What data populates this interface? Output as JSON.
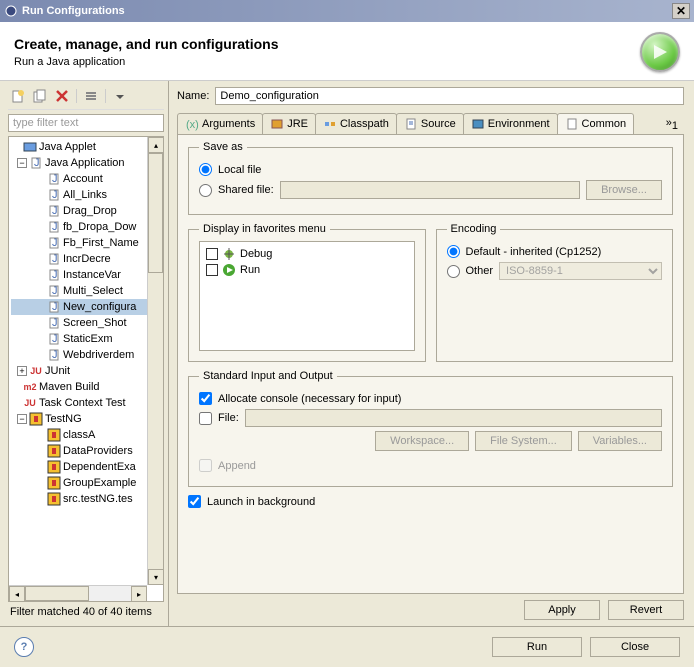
{
  "title": "Run Configurations",
  "header": {
    "title": "Create, manage, and run configurations",
    "subtitle": "Run a Java application"
  },
  "filter_placeholder": "type filter text",
  "filter_status": "Filter matched 40 of 40 items",
  "tree": {
    "java_applet": "Java Applet",
    "java_application": "Java Application",
    "items": [
      "Account",
      "All_Links",
      "Drag_Drop",
      "fb_Dropa_Dow",
      "Fb_First_Name",
      "IncrDecre",
      "InstanceVar",
      "Multi_Select",
      "New_configura",
      "Screen_Shot",
      "StaticExm",
      "Webdriverdem"
    ],
    "junit": "JUnit",
    "maven": "Maven Build",
    "task_context": "Task Context Test",
    "testng": "TestNG",
    "testng_items": [
      "classA",
      "DataProviders",
      "DependentExa",
      "GroupExample",
      "src.testNG.tes"
    ]
  },
  "name_label": "Name:",
  "name_value": "Demo_configuration",
  "tabs": {
    "arguments": "Arguments",
    "jre": "JRE",
    "classpath": "Classpath",
    "source": "Source",
    "environment": "Environment",
    "common": "Common",
    "overflow": "1"
  },
  "saveas": {
    "legend": "Save as",
    "local": "Local file",
    "shared": "Shared file:",
    "browse": "Browse..."
  },
  "fav": {
    "legend": "Display in favorites menu",
    "debug": "Debug",
    "run": "Run"
  },
  "enc": {
    "legend": "Encoding",
    "default": "Default - inherited (Cp1252)",
    "other": "Other",
    "value": "ISO-8859-1"
  },
  "io": {
    "legend": "Standard Input and Output",
    "allocate": "Allocate console (necessary for input)",
    "file": "File:",
    "workspace": "Workspace...",
    "filesystem": "File System...",
    "variables": "Variables...",
    "append": "Append"
  },
  "launch_bg": "Launch in background",
  "apply": "Apply",
  "revert": "Revert",
  "run": "Run",
  "close": "Close"
}
